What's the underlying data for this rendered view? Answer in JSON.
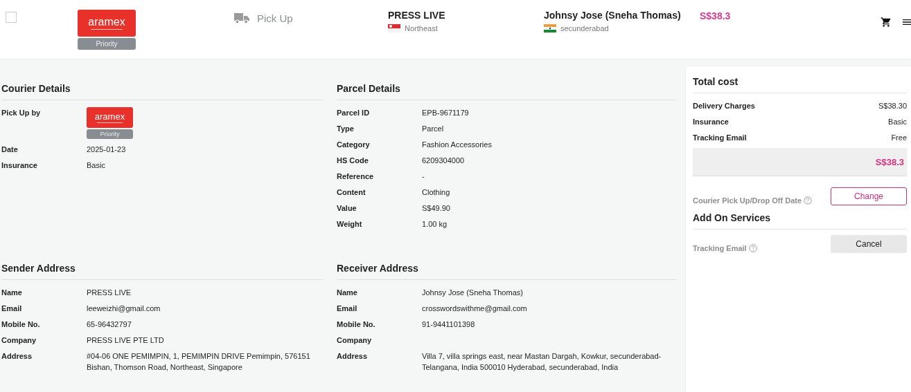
{
  "header": {
    "select": {
      "checked": false
    },
    "courier": {
      "logo": "aramex",
      "badge": "Priority"
    },
    "mode": "Pick Up",
    "sender": {
      "name": "PRESS LIVE",
      "region": "Northeast",
      "kind": "sg"
    },
    "receiver": {
      "name": "Johnsy Jose (Sneha Thomas)",
      "region": "secunderabad",
      "kind": "in"
    },
    "price": "S$38.3"
  },
  "courier_details": {
    "title": "Courier Details",
    "rows": [
      {
        "label": "Pick Up by",
        "kind": "logo",
        "logo": "aramex",
        "badge": "Priority"
      },
      {
        "label": "Date",
        "kind": "text",
        "value": "2025-01-23"
      },
      {
        "label": "Insurance",
        "kind": "text",
        "value": "Basic"
      }
    ]
  },
  "parcel_details": {
    "title": "Parcel Details",
    "rows": [
      {
        "label": "Parcel ID",
        "kind": "text",
        "value": "EPB-9671179"
      },
      {
        "label": "Type",
        "kind": "text",
        "value": "Parcel"
      },
      {
        "label": "Category",
        "kind": "text",
        "value": "Fashion Accessories"
      },
      {
        "label": "HS Code",
        "kind": "text",
        "value": "6209304000"
      },
      {
        "label": "Reference",
        "kind": "text",
        "value": "-"
      },
      {
        "label": "Content",
        "kind": "text",
        "value": "Clothing"
      },
      {
        "label": "Value",
        "kind": "text",
        "value": "S$49.90"
      },
      {
        "label": "Weight",
        "kind": "text",
        "value": "1.00 kg"
      }
    ]
  },
  "sender_address": {
    "title": "Sender Address",
    "rows": [
      {
        "label": "Name",
        "kind": "text",
        "value": "PRESS LIVE"
      },
      {
        "label": "Email",
        "kind": "text",
        "value": "leeweizhi@gmail.com"
      },
      {
        "label": "Mobile No.",
        "kind": "text",
        "value": "65-96432797"
      },
      {
        "label": "Company",
        "kind": "text",
        "value": "PRESS LIVE PTE LTD"
      },
      {
        "label": "Address",
        "kind": "text",
        "value": "#04-06 ONE PEMIMPIN, 1, PEMIMPIN DRIVE Pemimpin, 576151 Bishan, Thomson Road, Northeast, Singapore"
      }
    ]
  },
  "receiver_address": {
    "title": "Receiver Address",
    "rows": [
      {
        "label": "Name",
        "kind": "text",
        "value": "Johnsy Jose (Sneha Thomas)"
      },
      {
        "label": "Email",
        "kind": "text",
        "value": "crosswordswithme@gmail.com"
      },
      {
        "label": "Mobile No.",
        "kind": "text",
        "value": "91-9441101398"
      },
      {
        "label": "Company",
        "kind": "empty"
      },
      {
        "label": "Address",
        "kind": "text",
        "value": "Villa 7, villa springs east, near Mastan Dargah, Kowkur, secunderabad-Telangana, India 500010 Hyderabad, secunderabad, India"
      }
    ]
  },
  "total_cost": {
    "title": "Total cost",
    "rows": [
      {
        "label": "Delivery Charges",
        "value": "S$38.30"
      },
      {
        "label": "Insurance",
        "value": "Basic"
      },
      {
        "label": "Tracking Email",
        "value": "Free"
      }
    ],
    "total": "S$38.3",
    "date_label": "Courier Pick Up/Drop Off Date",
    "change_button": "Change"
  },
  "add_on_services": {
    "title": "Add On Services",
    "items": [
      {
        "label": "Tracking Email",
        "button": "Cancel"
      }
    ]
  }
}
